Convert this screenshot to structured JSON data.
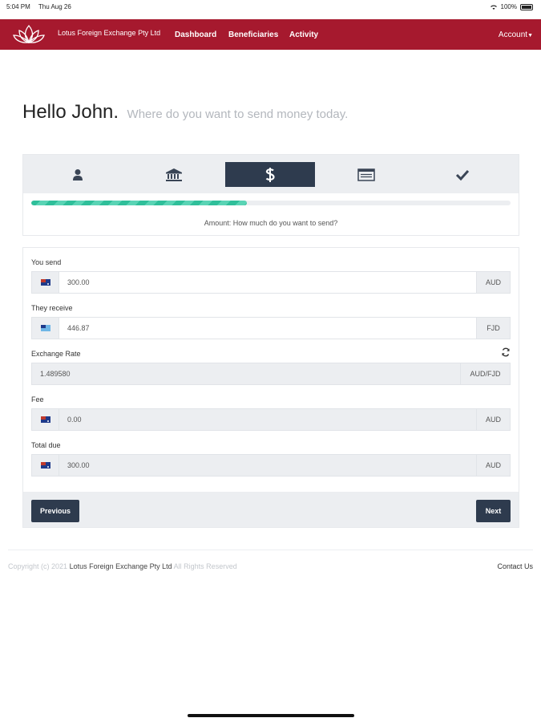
{
  "status_bar": {
    "time": "5:04 PM",
    "date": "Thu Aug 26",
    "battery": "100%"
  },
  "header": {
    "brand": "Lotus Foreign Exchange Pty Ltd",
    "nav": {
      "dashboard": "Dashboard",
      "beneficiaries": "Beneficiaries",
      "activity": "Activity",
      "account": "Account"
    }
  },
  "greeting": {
    "hello": "Hello John.",
    "subtitle": "Where do you want to send money today."
  },
  "steps": {
    "items": [
      {
        "icon": "user-icon",
        "active": false
      },
      {
        "icon": "bank-icon",
        "active": false
      },
      {
        "icon": "dollar-icon",
        "active": true
      },
      {
        "icon": "card-list-icon",
        "active": false
      },
      {
        "icon": "checkmark-icon",
        "active": false
      }
    ],
    "progress_percent": 45,
    "caption": "Amount: How much do you want to send?"
  },
  "form": {
    "you_send": {
      "label": "You send",
      "value": "300.00",
      "currency": "AUD",
      "flag": "au-flag-icon"
    },
    "they_receive": {
      "label": "They receive",
      "value": "446.87",
      "currency": "FJD",
      "flag": "fj-flag-icon"
    },
    "exchange_rate": {
      "label": "Exchange Rate",
      "value": "1.489580",
      "pair": "AUD/FJD"
    },
    "fee": {
      "label": "Fee",
      "value": "0.00",
      "currency": "AUD",
      "flag": "au-flag-icon"
    },
    "total_due": {
      "label": "Total due",
      "value": "300.00",
      "currency": "AUD",
      "flag": "au-flag-icon"
    },
    "previous_label": "Previous",
    "next_label": "Next"
  },
  "footer": {
    "copyright_prefix": "Copyright (c) 2021",
    "company": "Lotus Foreign Exchange Pty Ltd",
    "rights": "All Rights Reserved",
    "contact": "Contact Us"
  },
  "colors": {
    "brand": "#a6192e",
    "dark": "#2e3b4e",
    "progress": "#2fbf9a",
    "panel": "#eceef1"
  }
}
